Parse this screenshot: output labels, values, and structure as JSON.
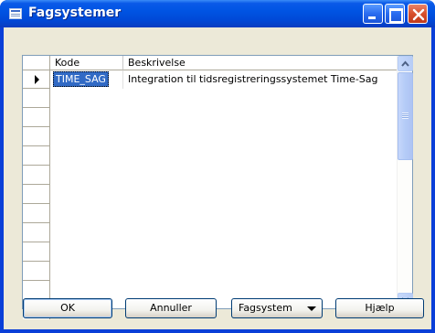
{
  "window": {
    "title": "Fagsystemer",
    "icon": "table-icon"
  },
  "table": {
    "columns": [
      "Kode",
      "Beskrivelse"
    ],
    "rows": [
      {
        "kode": "TIME_SAG",
        "beskrivelse": "Integration til tidsregistreringssystemet Time-Sag"
      }
    ],
    "selected_row": 0
  },
  "buttons": {
    "ok": "OK",
    "annuller": "Annuller",
    "fagsystem": "Fagsystem",
    "hjaelp": "Hjælp"
  },
  "colors": {
    "titlebar": "#0054e3",
    "selection": "#316ac5",
    "face": "#ece9d8"
  }
}
